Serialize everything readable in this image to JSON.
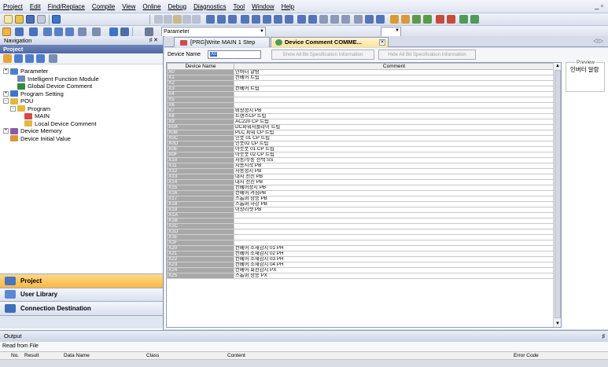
{
  "menu": [
    "Project",
    "Edit",
    "Find/Replace",
    "Compile",
    "View",
    "Online",
    "Debug",
    "Diagnostics",
    "Tool",
    "Window",
    "Help"
  ],
  "window_controls": "_ ▫",
  "toolbar": {
    "parameter_select": "Parameter"
  },
  "navigation": {
    "title": "Navigation",
    "title_controls": "♯ ✕",
    "section": "Project",
    "tree": [
      {
        "label": "Parameter",
        "indent": 0,
        "expander": "+",
        "color": "#4f7ccd"
      },
      {
        "label": "Intelligent Function Module",
        "indent": 1,
        "expander": "",
        "color": "#6c87b9"
      },
      {
        "label": "Global Device Comment",
        "indent": 1,
        "expander": "",
        "color": "#2f8a3b"
      },
      {
        "label": "Program Setting",
        "indent": 0,
        "expander": "+",
        "color": "#3f74c9"
      },
      {
        "label": "POU",
        "indent": 0,
        "expander": "-",
        "color": "#e2b842"
      },
      {
        "label": "Program",
        "indent": 1,
        "expander": "-",
        "color": "#e2b842"
      },
      {
        "label": "MAIN",
        "indent": 2,
        "expander": "",
        "color": "#d24a4a"
      },
      {
        "label": "Local Device Comment",
        "indent": 2,
        "expander": "",
        "color": "#e2b842"
      },
      {
        "label": "Device Memory",
        "indent": 0,
        "expander": "+",
        "color": "#8a5aa8"
      },
      {
        "label": "Device Initial Value",
        "indent": 0,
        "expander": "",
        "color": "#d6983e"
      }
    ],
    "bottom_buttons": [
      {
        "label": "Project",
        "active": true,
        "color": "#4a73c2"
      },
      {
        "label": "User Library",
        "active": false,
        "color": "#5b8ad1"
      },
      {
        "label": "Connection Destination",
        "active": false,
        "color": "#3c6fb8"
      }
    ]
  },
  "tabs": [
    {
      "label": "[PRG]Write MAIN 1 Step",
      "active": false
    },
    {
      "label": "Device Comment COMME...",
      "active": true
    }
  ],
  "tab_nav": "◁ ▷",
  "device_bar": {
    "label": "Device Name",
    "value": "X0",
    "show_btn": "Show All Bit Specification Information",
    "hide_btn": "Hide All Bit Specification Information"
  },
  "grid": {
    "columns": [
      "Device Name",
      "Comment"
    ],
    "rows": [
      [
        "X0",
        "인버터 알람"
      ],
      [
        "X1",
        "컨베어 트립"
      ],
      [
        "X2",
        ""
      ],
      [
        "X3",
        "컨베어 트립"
      ],
      [
        "X4",
        ""
      ],
      [
        "X5",
        ""
      ],
      [
        "X6",
        ""
      ],
      [
        "X7",
        "비상정지 PB"
      ],
      [
        "X8",
        "트랜스CP 트립"
      ],
      [
        "X9",
        "AC220 CP 트립"
      ],
      [
        "X0A",
        "DC파워서플라이 트립"
      ],
      [
        "X0B",
        "PLC 파워 CP 트립"
      ],
      [
        "X0C",
        "인풋 01 CP 트립"
      ],
      [
        "X0D",
        "인풋02 CP 트립"
      ],
      [
        "X0E",
        "아웃풋 01 CP 트립"
      ],
      [
        "X0F",
        "아웃풋 02 CP 트립"
      ],
      [
        "X10",
        "자동/수동 선택 SS"
      ],
      [
        "X11",
        "자동시작 PB"
      ],
      [
        "X12",
        "자동정지 PB"
      ],
      [
        "X13",
        "대차 전진 PB"
      ],
      [
        "X14",
        "대차 전진 PB"
      ],
      [
        "X15",
        "컨베어정지 PB"
      ],
      [
        "X16",
        "컨베어 켜짐PB"
      ],
      [
        "X17",
        "스톱퍼 상승 PB"
      ],
      [
        "X18",
        "스톱퍼 하강 PB"
      ],
      [
        "X19",
        "이상리셋 PB"
      ],
      [
        "X1A",
        ""
      ],
      [
        "X1B",
        ""
      ],
      [
        "X1C",
        ""
      ],
      [
        "X1D",
        ""
      ],
      [
        "X1E",
        ""
      ],
      [
        "X1F",
        ""
      ],
      [
        "X20",
        "컨베어 소재감지 01 PH"
      ],
      [
        "X21",
        "컨베어 소재감지 02 PH"
      ],
      [
        "X22",
        "컨베어 소재감지 03 PH"
      ],
      [
        "X23",
        "컨베어 소재감지 04 PH"
      ],
      [
        "X24",
        "컨베어 회전감지 PX"
      ],
      [
        "X25",
        "스톱퍼 상승 PX"
      ]
    ]
  },
  "preview": {
    "legend": "Preview",
    "text": "인버터 알람"
  },
  "output": {
    "title": "Output",
    "pin": "♯",
    "subtitle": "Read from File",
    "columns": [
      "No.",
      "Result",
      "Data Name",
      "Class",
      "Content",
      "Error Code"
    ]
  }
}
